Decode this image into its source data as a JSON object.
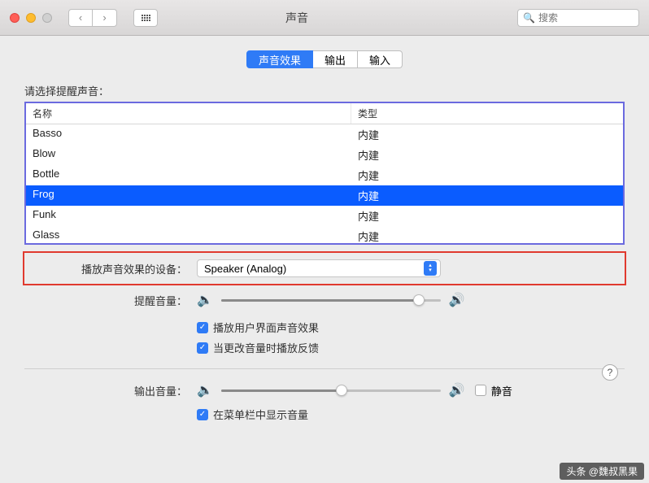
{
  "window": {
    "title": "声音"
  },
  "search": {
    "placeholder": "搜索"
  },
  "tabs": [
    {
      "label": "声音效果",
      "active": true
    },
    {
      "label": "输出",
      "active": false
    },
    {
      "label": "输入",
      "active": false
    }
  ],
  "prompt": "请选择提醒声音：",
  "columns": {
    "name": "名称",
    "type": "类型"
  },
  "sounds": [
    {
      "name": "Basso",
      "type": "内建",
      "selected": false
    },
    {
      "name": "Blow",
      "type": "内建",
      "selected": false
    },
    {
      "name": "Bottle",
      "type": "内建",
      "selected": false
    },
    {
      "name": "Frog",
      "type": "内建",
      "selected": true
    },
    {
      "name": "Funk",
      "type": "内建",
      "selected": false
    },
    {
      "name": "Glass",
      "type": "内建",
      "selected": false
    }
  ],
  "device": {
    "label": "播放声音效果的设备：",
    "value": "Speaker (Analog)"
  },
  "alert_volume": {
    "label": "提醒音量：",
    "value": 90
  },
  "checks": {
    "ui_sound": "播放用户界面声音效果",
    "feedback": "当更改音量时播放反馈"
  },
  "output_volume": {
    "label": "输出音量：",
    "value": 55
  },
  "mute": {
    "label": "静音",
    "checked": false
  },
  "menubar": {
    "label": "在菜单栏中显示音量",
    "checked": true
  },
  "attribution": "头条 @魏叔黑果"
}
